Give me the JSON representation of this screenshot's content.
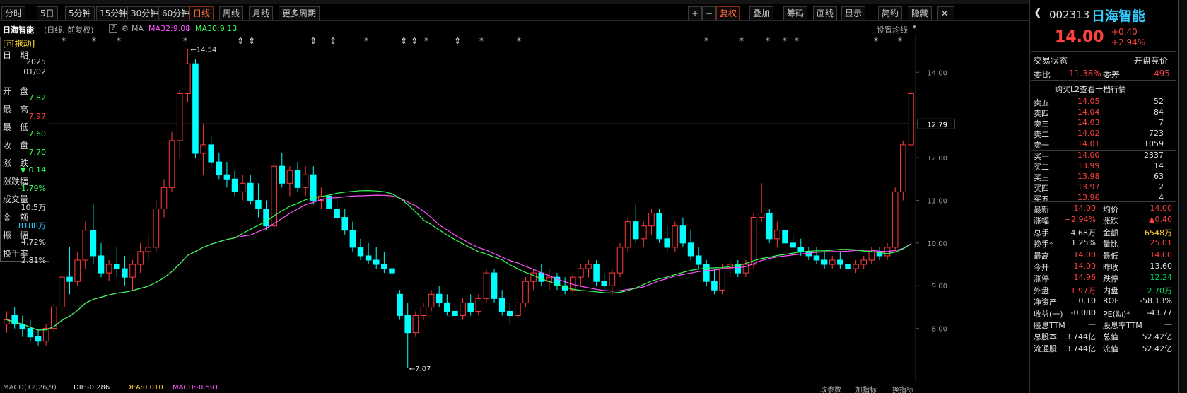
{
  "toolbar": {
    "tabs": [
      "分时",
      "5日",
      "5分钟",
      "15分钟",
      "30分钟",
      "60分钟",
      "日线",
      "周线",
      "月线",
      "更多周期"
    ],
    "right_buttons": [
      "+",
      "−",
      "复权",
      "叠加",
      "筹码",
      "画线",
      "显示",
      "简约",
      "隐藏"
    ]
  },
  "info": {
    "name": "日海智能",
    "params": "(日线, 前复权)",
    "ma_label": "MA",
    "ma32": "MA32:9.08",
    "ma30": "MA30:9.13",
    "settings": "设置均线"
  },
  "left_panel": {
    "title": "[可拖动]",
    "rows": [
      {
        "label": "日　期",
        "value": "2025"
      },
      {
        "label": "",
        "value": "01/02"
      },
      {
        "label": "开　盘",
        "value": "7.82"
      },
      {
        "label": "最　高",
        "value": "7.97"
      },
      {
        "label": "最　低",
        "value": "7.60"
      },
      {
        "label": "收　盘",
        "value": "7.70"
      },
      {
        "label": "涨　跌",
        "value": "▼ 0.14"
      },
      {
        "label": "涨跌幅",
        "value": "-1.79%"
      },
      {
        "label": "成交量",
        "value": "10.5万"
      },
      {
        "label": "金　额",
        "value": "8188万"
      },
      {
        "label": "振　幅",
        "value": "4.72%"
      },
      {
        "label": "换手率",
        "value": "2.81%"
      }
    ]
  },
  "price_axis": [
    "14.00",
    "12.79",
    "12.00",
    "11.00",
    "10.00",
    "9.00",
    "8.00"
  ],
  "annotations": {
    "high": "14.54",
    "low": "7.07"
  },
  "macd": {
    "label": "MACD(12,26,9)",
    "dif": "DIF:-0.286",
    "dea": "DEA:0.010",
    "macd": "MACD:-0.591",
    "buttons": [
      "改参数",
      "加指标",
      "换指标"
    ]
  },
  "quote": {
    "code": "002313",
    "name": "日海智能",
    "price": "14.00",
    "change": "+0.40",
    "pct": "+2.94%",
    "status_label": "交易状态",
    "status": "开盘竞价",
    "wb_label": "委比",
    "wb": "11.38%",
    "wc_label": "委差",
    "wc": "495",
    "l2": "购买L2查看十档行情",
    "asks": [
      [
        "卖五",
        "14.05",
        "52"
      ],
      [
        "卖四",
        "14.04",
        "84"
      ],
      [
        "卖三",
        "14.03",
        "7"
      ],
      [
        "卖二",
        "14.02",
        "723"
      ],
      [
        "卖一",
        "14.01",
        "1059"
      ]
    ],
    "bids": [
      [
        "买一",
        "14.00",
        "2337"
      ],
      [
        "买二",
        "13.99",
        "14"
      ],
      [
        "买三",
        "13.98",
        "63"
      ],
      [
        "买四",
        "13.97",
        "2"
      ],
      [
        "买五",
        "13.96",
        "4"
      ]
    ],
    "stats": [
      [
        "最新",
        "14.00",
        "均价",
        "14.00"
      ],
      [
        "涨幅",
        "+2.94%",
        "涨跌",
        "▲0.40"
      ],
      [
        "总手",
        "4.68万",
        "金额",
        "6548万"
      ],
      [
        "换手*",
        "1.25%",
        "量比",
        "25.01"
      ],
      [
        "最高",
        "14.00",
        "最低",
        "14.00"
      ],
      [
        "今开",
        "14.00",
        "昨收",
        "13.60"
      ],
      [
        "涨停",
        "14.96",
        "跌停",
        "12.24"
      ],
      [
        "外盘",
        "1.97万",
        "内盘",
        "2.70万"
      ],
      [
        "净资产",
        "0.10",
        "ROE",
        "-58.13%"
      ],
      [
        "收益(一)",
        "-0.080",
        "PE(动)*",
        "-43.77"
      ],
      [
        "股息TTM",
        "—",
        "股息率TTM",
        "—"
      ],
      [
        "总股本",
        "3.744亿",
        "总值",
        "52.42亿"
      ],
      [
        "流通股",
        "3.744亿",
        "流值",
        "52.42亿"
      ]
    ]
  },
  "chart_data": {
    "type": "candlestick",
    "ylim": [
      7.0,
      14.7
    ],
    "current_price_line": 12.79,
    "candles": [
      [
        8.1,
        8.4,
        7.9,
        8.2
      ],
      [
        8.3,
        8.5,
        8.0,
        8.1
      ],
      [
        8.1,
        8.3,
        7.8,
        8.0
      ],
      [
        8.0,
        8.2,
        7.7,
        7.8
      ],
      [
        7.82,
        7.97,
        7.6,
        7.7
      ],
      [
        7.7,
        8.1,
        7.6,
        8.0
      ],
      [
        8.0,
        8.6,
        7.9,
        8.5
      ],
      [
        8.5,
        9.3,
        8.3,
        9.2
      ],
      [
        9.2,
        9.9,
        8.8,
        9.1
      ],
      [
        9.1,
        9.8,
        9.0,
        9.6
      ],
      [
        9.6,
        10.5,
        9.4,
        10.3
      ],
      [
        10.3,
        10.9,
        9.5,
        9.7
      ],
      [
        9.7,
        10.0,
        9.2,
        9.3
      ],
      [
        9.3,
        9.6,
        9.1,
        9.5
      ],
      [
        9.5,
        9.9,
        9.2,
        9.4
      ],
      [
        9.4,
        9.7,
        9.0,
        9.2
      ],
      [
        9.2,
        9.6,
        8.9,
        9.5
      ],
      [
        9.5,
        10.0,
        9.3,
        9.8
      ],
      [
        9.8,
        10.2,
        9.6,
        9.9
      ],
      [
        9.9,
        11.0,
        9.8,
        10.8
      ],
      [
        10.8,
        11.5,
        10.6,
        11.3
      ],
      [
        11.3,
        12.6,
        11.2,
        12.4
      ],
      [
        12.4,
        13.6,
        12.0,
        13.5
      ],
      [
        13.5,
        14.54,
        13.3,
        14.2
      ],
      [
        14.2,
        14.3,
        12.0,
        12.1
      ],
      [
        12.1,
        12.8,
        11.6,
        12.3
      ],
      [
        12.3,
        12.5,
        11.8,
        11.9
      ],
      [
        11.9,
        12.1,
        11.5,
        11.6
      ],
      [
        11.6,
        11.9,
        11.3,
        11.5
      ],
      [
        11.5,
        11.7,
        11.1,
        11.2
      ],
      [
        11.2,
        11.6,
        11.0,
        11.4
      ],
      [
        11.4,
        11.6,
        10.9,
        11.0
      ],
      [
        11.0,
        11.4,
        10.6,
        10.8
      ],
      [
        10.8,
        11.0,
        10.3,
        10.4
      ],
      [
        10.4,
        11.9,
        10.3,
        11.8
      ],
      [
        11.8,
        12.1,
        11.3,
        11.4
      ],
      [
        11.4,
        11.8,
        11.1,
        11.7
      ],
      [
        11.7,
        11.9,
        11.2,
        11.3
      ],
      [
        11.3,
        11.8,
        11.1,
        11.6
      ],
      [
        11.6,
        11.8,
        10.9,
        11.0
      ],
      [
        11.0,
        11.3,
        10.8,
        11.1
      ],
      [
        11.1,
        11.2,
        10.7,
        10.8
      ],
      [
        10.8,
        11.0,
        10.5,
        10.6
      ],
      [
        10.6,
        10.8,
        10.2,
        10.3
      ],
      [
        10.3,
        10.5,
        9.8,
        9.9
      ],
      [
        9.9,
        10.1,
        9.6,
        9.7
      ],
      [
        9.7,
        10.0,
        9.5,
        9.6
      ],
      [
        9.6,
        9.9,
        9.4,
        9.5
      ],
      [
        9.5,
        9.8,
        9.3,
        9.4
      ],
      [
        9.4,
        9.6,
        9.2,
        9.3
      ],
      [
        8.8,
        8.9,
        8.2,
        8.3
      ],
      [
        8.3,
        8.6,
        7.07,
        7.9
      ],
      [
        7.9,
        8.4,
        7.8,
        8.3
      ],
      [
        8.3,
        8.6,
        8.2,
        8.5
      ],
      [
        8.5,
        8.9,
        8.4,
        8.8
      ],
      [
        8.8,
        9.0,
        8.5,
        8.6
      ],
      [
        8.6,
        8.8,
        8.3,
        8.4
      ],
      [
        8.4,
        8.6,
        8.2,
        8.3
      ],
      [
        8.3,
        8.7,
        8.2,
        8.6
      ],
      [
        8.6,
        8.8,
        8.3,
        8.4
      ],
      [
        8.4,
        8.8,
        8.3,
        8.7
      ],
      [
        8.7,
        9.4,
        8.6,
        9.3
      ],
      [
        9.3,
        9.4,
        8.6,
        8.7
      ],
      [
        8.7,
        8.9,
        8.3,
        8.4
      ],
      [
        8.4,
        8.6,
        8.1,
        8.3
      ],
      [
        8.3,
        8.7,
        8.2,
        8.6
      ],
      [
        8.6,
        9.2,
        8.5,
        9.1
      ],
      [
        9.1,
        9.4,
        8.9,
        9.3
      ],
      [
        9.3,
        9.5,
        9.0,
        9.1
      ],
      [
        9.1,
        9.4,
        8.9,
        9.2
      ],
      [
        9.2,
        9.3,
        8.9,
        9.0
      ],
      [
        9.0,
        9.2,
        8.8,
        8.9
      ],
      [
        8.9,
        9.3,
        8.8,
        9.2
      ],
      [
        9.2,
        9.5,
        9.0,
        9.4
      ],
      [
        9.4,
        9.6,
        9.2,
        9.5
      ],
      [
        9.5,
        9.6,
        9.0,
        9.1
      ],
      [
        9.1,
        9.3,
        8.9,
        9.0
      ],
      [
        9.0,
        9.4,
        8.8,
        9.3
      ],
      [
        9.3,
        10.0,
        9.2,
        9.9
      ],
      [
        9.9,
        10.6,
        9.8,
        10.5
      ],
      [
        10.5,
        10.9,
        10.0,
        10.1
      ],
      [
        10.1,
        10.5,
        9.9,
        10.4
      ],
      [
        10.4,
        10.8,
        10.2,
        10.7
      ],
      [
        10.7,
        10.8,
        10.0,
        10.1
      ],
      [
        10.1,
        10.4,
        9.8,
        9.9
      ],
      [
        9.9,
        10.5,
        9.8,
        10.4
      ],
      [
        10.4,
        10.6,
        9.9,
        10.0
      ],
      [
        10.0,
        10.3,
        9.6,
        9.7
      ],
      [
        9.7,
        9.9,
        9.4,
        9.5
      ],
      [
        9.5,
        9.6,
        9.0,
        9.1
      ],
      [
        9.1,
        9.4,
        8.8,
        8.9
      ],
      [
        8.9,
        9.5,
        8.8,
        9.4
      ],
      [
        9.4,
        9.6,
        9.2,
        9.5
      ],
      [
        9.5,
        9.6,
        9.2,
        9.3
      ],
      [
        9.3,
        9.6,
        9.2,
        9.5
      ],
      [
        9.5,
        10.7,
        9.4,
        10.6
      ],
      [
        10.6,
        11.4,
        10.5,
        10.7
      ],
      [
        10.7,
        10.8,
        10.0,
        10.1
      ],
      [
        10.1,
        10.5,
        9.9,
        10.3
      ],
      [
        10.3,
        10.6,
        9.9,
        10.0
      ],
      [
        10.0,
        10.2,
        9.8,
        9.9
      ],
      [
        9.9,
        10.1,
        9.7,
        9.8
      ],
      [
        9.8,
        9.9,
        9.6,
        9.7
      ],
      [
        9.7,
        9.9,
        9.5,
        9.6
      ],
      [
        9.6,
        9.8,
        9.4,
        9.5
      ],
      [
        9.5,
        9.7,
        9.4,
        9.6
      ],
      [
        9.6,
        9.8,
        9.4,
        9.5
      ],
      [
        9.5,
        9.7,
        9.3,
        9.4
      ],
      [
        9.4,
        9.6,
        9.3,
        9.5
      ],
      [
        9.5,
        9.7,
        9.4,
        9.6
      ],
      [
        9.6,
        9.9,
        9.5,
        9.8
      ],
      [
        9.8,
        9.9,
        9.6,
        9.7
      ],
      [
        9.7,
        10.0,
        9.6,
        9.9
      ],
      [
        9.9,
        11.3,
        9.8,
        11.2
      ],
      [
        11.2,
        12.4,
        11.0,
        12.3
      ],
      [
        12.3,
        13.6,
        12.2,
        13.5
      ]
    ]
  }
}
